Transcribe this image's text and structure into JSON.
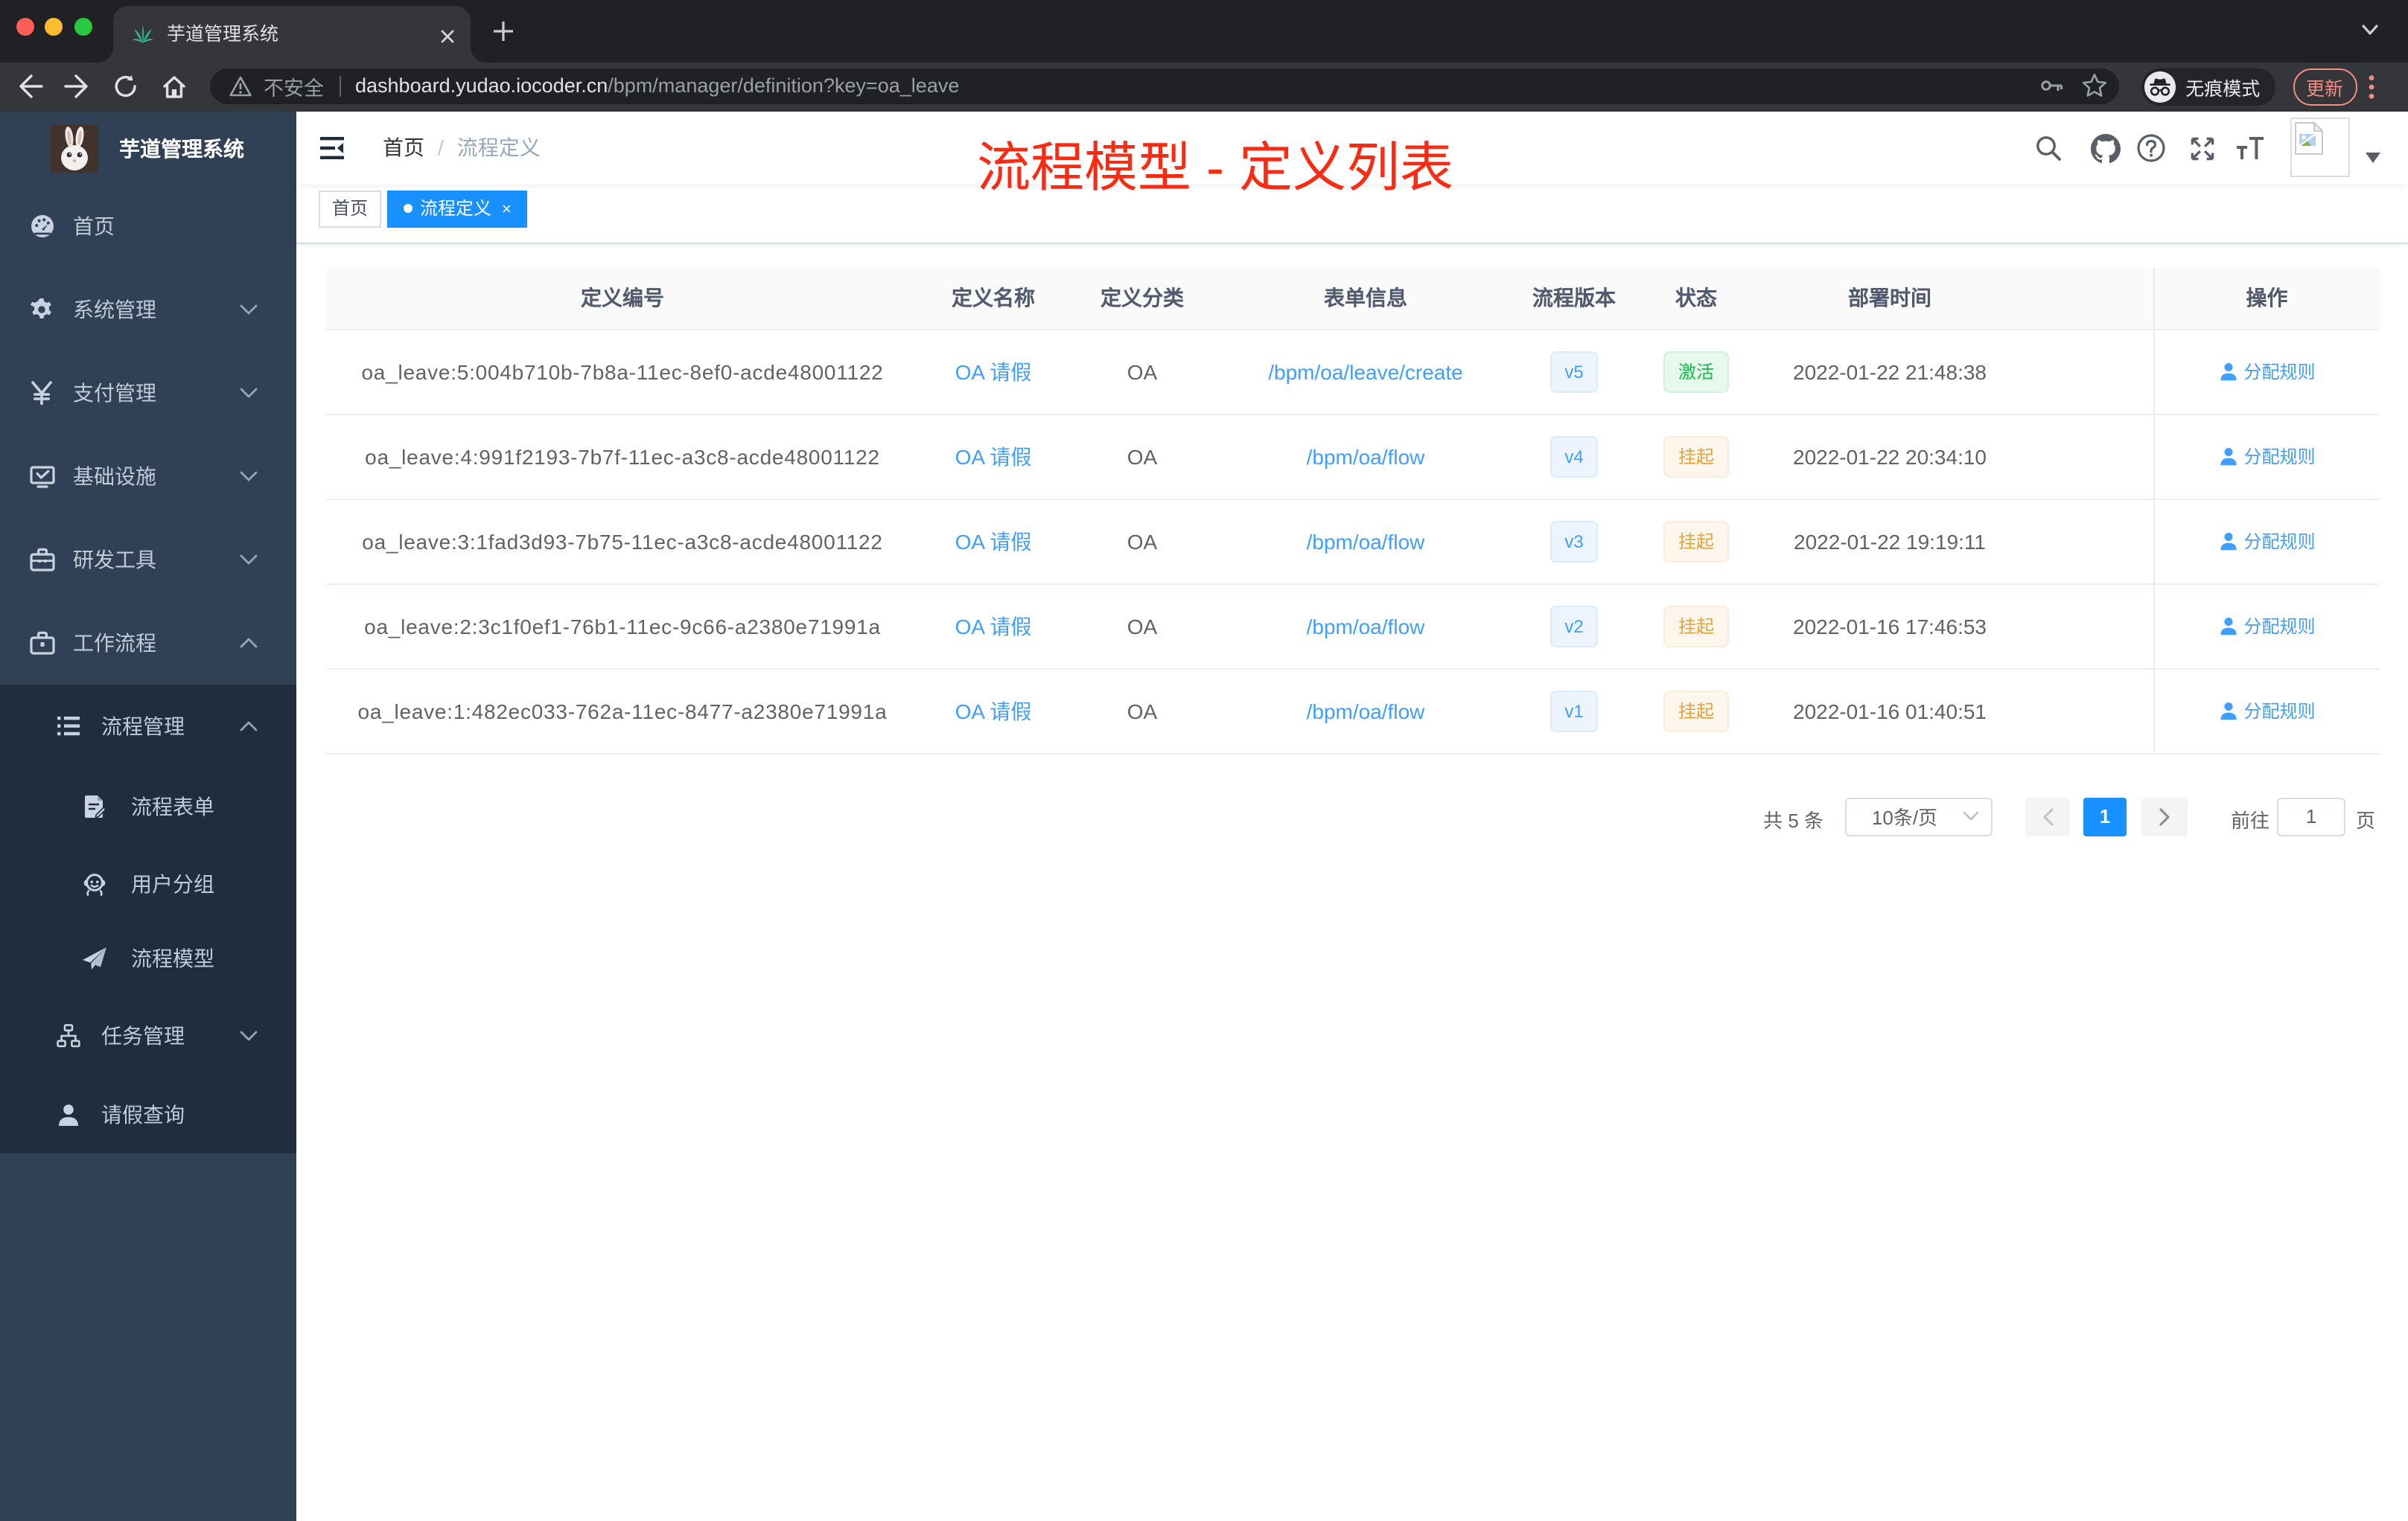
{
  "browser": {
    "tab_title": "芋道管理系统",
    "security_label": "不安全",
    "url_host": "dashboard.yudao.iocoder.cn",
    "url_path": "/bpm/manager/definition?key=oa_leave",
    "incognito_label": "无痕模式",
    "update_label": "更新"
  },
  "sidebar": {
    "logo_title": "芋道管理系统",
    "menu": [
      {
        "label": "首页",
        "icon": "dashboard-icon"
      },
      {
        "label": "系统管理",
        "icon": "gear-icon",
        "arrow": "down"
      },
      {
        "label": "支付管理",
        "icon": "yen-icon",
        "arrow": "down"
      },
      {
        "label": "基础设施",
        "icon": "infrastructure-icon",
        "arrow": "down"
      },
      {
        "label": "研发工具",
        "icon": "toolbox-icon",
        "arrow": "down"
      },
      {
        "label": "工作流程",
        "icon": "briefcase-icon",
        "arrow": "up"
      }
    ],
    "submenu": [
      {
        "label": "流程管理",
        "icon": "process-list-icon",
        "arrow": "up"
      },
      {
        "label": "流程表单",
        "icon": "form-edit-icon"
      },
      {
        "label": "用户分组",
        "icon": "user-group-icon"
      },
      {
        "label": "流程模型",
        "icon": "paper-plane-icon"
      },
      {
        "label": "任务管理",
        "icon": "task-tree-icon",
        "arrow": "down"
      },
      {
        "label": "请假查询",
        "icon": "person-icon"
      }
    ]
  },
  "header": {
    "breadcrumb": {
      "home": "首页",
      "current": "流程定义"
    },
    "annotation": "流程模型 - 定义列表"
  },
  "tags": {
    "home": "首页",
    "active": "流程定义"
  },
  "table": {
    "columns": [
      "定义编号",
      "定义名称",
      "定义分类",
      "表单信息",
      "流程版本",
      "状态",
      "部署时间",
      "操作"
    ],
    "action_label": "分配规则",
    "rows": [
      {
        "id": "oa_leave:5:004b710b-7b8a-11ec-8ef0-acde48001122",
        "name": "OA 请假",
        "category": "OA",
        "form": "/bpm/oa/leave/create",
        "version": "v5",
        "status": "激活",
        "status_type": "success",
        "deployed_at": "2022-01-22 21:48:38"
      },
      {
        "id": "oa_leave:4:991f2193-7b7f-11ec-a3c8-acde48001122",
        "name": "OA 请假",
        "category": "OA",
        "form": "/bpm/oa/flow",
        "version": "v4",
        "status": "挂起",
        "status_type": "warning",
        "deployed_at": "2022-01-22 20:34:10"
      },
      {
        "id": "oa_leave:3:1fad3d93-7b75-11ec-a3c8-acde48001122",
        "name": "OA 请假",
        "category": "OA",
        "form": "/bpm/oa/flow",
        "version": "v3",
        "status": "挂起",
        "status_type": "warning",
        "deployed_at": "2022-01-22 19:19:11"
      },
      {
        "id": "oa_leave:2:3c1f0ef1-76b1-11ec-9c66-a2380e71991a",
        "name": "OA 请假",
        "category": "OA",
        "form": "/bpm/oa/flow",
        "version": "v2",
        "status": "挂起",
        "status_type": "warning",
        "deployed_at": "2022-01-16 17:46:53"
      },
      {
        "id": "oa_leave:1:482ec033-762a-11ec-8477-a2380e71991a",
        "name": "OA 请假",
        "category": "OA",
        "form": "/bpm/oa/flow",
        "version": "v1",
        "status": "挂起",
        "status_type": "warning",
        "deployed_at": "2022-01-16 01:40:51"
      }
    ]
  },
  "pagination": {
    "total_label": "共 5 条",
    "page_size": "10条/页",
    "current_page": "1",
    "goto_label": "前往",
    "goto_value": "1",
    "unit_label": "页"
  },
  "colors": {
    "primary": "#409eff",
    "active_blue": "#1890ff",
    "success_text": "#0fbf4b",
    "warning_text": "#e6a23c",
    "sidebar_bg": "#304156",
    "submenu_bg": "#1f2d3d",
    "annotation_red": "#fa2a13"
  }
}
